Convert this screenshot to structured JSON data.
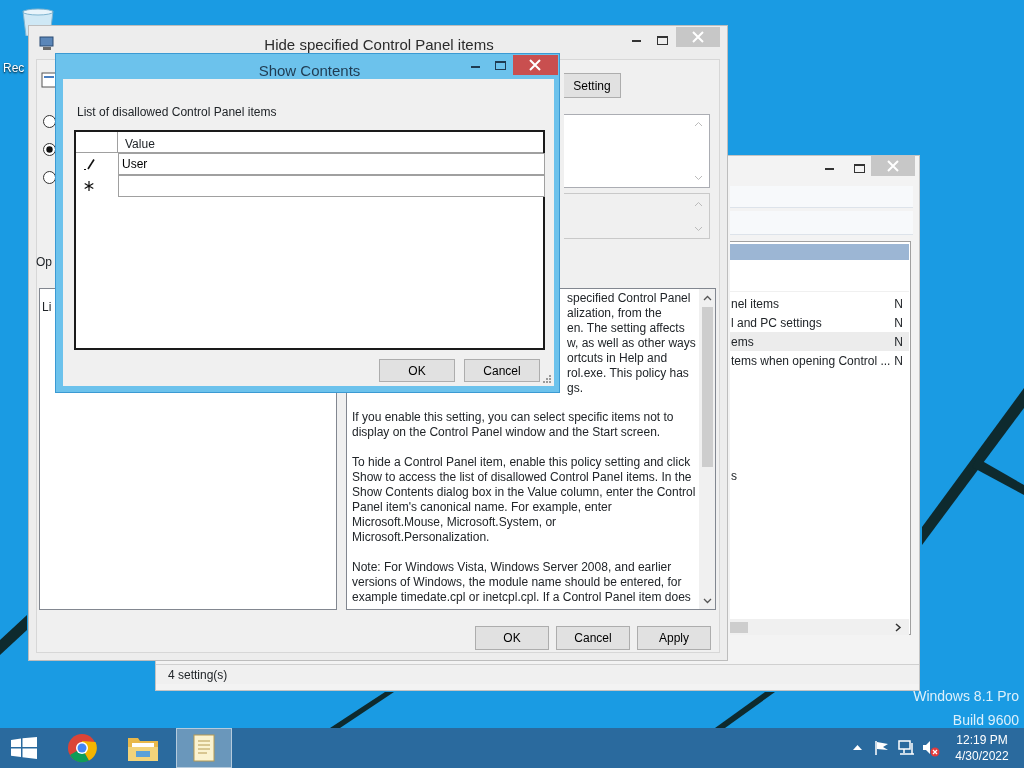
{
  "desktop": {
    "recycle_bin_label": "Rec",
    "watermark": [
      "Windows 8.1 Pro",
      "Build 9600"
    ]
  },
  "back_window": {
    "rows": [
      {
        "name": "nel items",
        "state": "N",
        "selected": false
      },
      {
        "name": "l and PC settings",
        "state": "N",
        "selected": false
      },
      {
        "name": "ems",
        "state": "N",
        "selected": true
      },
      {
        "name": "tems when opening Control ...",
        "state": "N",
        "selected": false
      }
    ],
    "partial_text": "s",
    "status": "4 setting(s)"
  },
  "policy_window": {
    "title": "Hide specified Control Panel items",
    "setting_button": "Setting",
    "radios": [
      {
        "selected": false
      },
      {
        "selected": true
      },
      {
        "selected": false
      }
    ],
    "options_label": "Op",
    "list_label": "Li",
    "help_partial_lines": [
      "specified Control Panel",
      "alization, from the",
      "en. The setting affects",
      "w, as well as other ways",
      "ortcuts in Help and",
      "rol.exe. This policy has",
      "gs."
    ],
    "help_paragraphs": [
      "If you enable this setting, you can select specific items not to\ndisplay on the Control Panel window and the Start screen.",
      "To hide a Control Panel item, enable this policy setting and click\nShow to access the list of disallowed Control Panel items. In the\nShow Contents dialog box in the Value column, enter the Control\nPanel item's canonical name. For example, enter\nMicrosoft.Mouse, Microsoft.System, or\nMicrosoft.Personalization.",
      "Note: For Windows Vista, Windows Server 2008, and earlier\nversions of Windows, the module name should be entered, for\nexample timedate.cpl or inetcpl.cpl. If a Control Panel item does"
    ],
    "buttons": [
      "OK",
      "Cancel",
      "Apply"
    ]
  },
  "show_contents": {
    "title": "Show Contents",
    "label": "List of disallowed Control Panel items",
    "column": "Value",
    "rows": [
      {
        "kind": "editing",
        "value": "User"
      },
      {
        "kind": "new"
      }
    ],
    "buttons": [
      "OK",
      "Cancel"
    ]
  },
  "taskbar": {
    "apps": [
      {
        "kind": "browser",
        "selected": false
      },
      {
        "kind": "folder",
        "selected": false
      },
      {
        "kind": "notepad",
        "selected": true
      }
    ],
    "time": "12:19 PM",
    "date": "4/30/2022"
  }
}
